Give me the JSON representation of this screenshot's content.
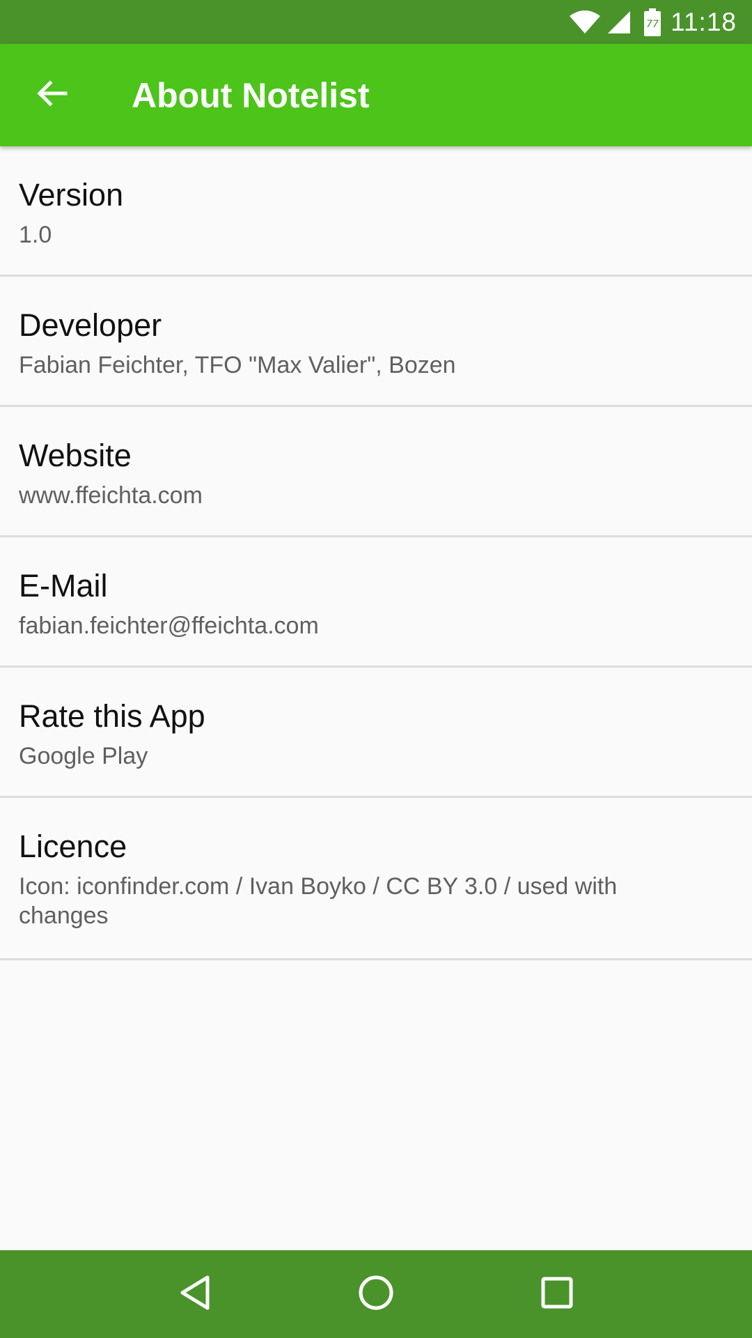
{
  "status_bar": {
    "time": "11:18",
    "battery_level": "77",
    "icons": [
      "wifi-icon",
      "signal-icon",
      "battery-icon"
    ]
  },
  "app_bar": {
    "title": "About Notelist",
    "back_icon": "arrow-back-icon"
  },
  "items": [
    {
      "title": "Version",
      "subtitle": "1.0"
    },
    {
      "title": "Developer",
      "subtitle": "Fabian Feichter, TFO \"Max Valier\", Bozen"
    },
    {
      "title": "Website",
      "subtitle": "www.ffeichta.com"
    },
    {
      "title": "E-Mail",
      "subtitle": "fabian.feichter@ffeichta.com"
    },
    {
      "title": "Rate this App",
      "subtitle": "Google Play"
    },
    {
      "title": "Licence",
      "subtitle": "Icon: iconfinder.com / Ivan Boyko / CC BY 3.0 / used with changes"
    }
  ],
  "nav_bar": {
    "buttons": [
      "back-triangle-icon",
      "home-circle-icon",
      "recents-square-icon"
    ]
  },
  "colors": {
    "status_bar": "#4a932b",
    "app_bar": "#4cc41a",
    "nav_bar": "#4a932b",
    "background": "#fafafa",
    "divider": "#dcdcdc"
  }
}
